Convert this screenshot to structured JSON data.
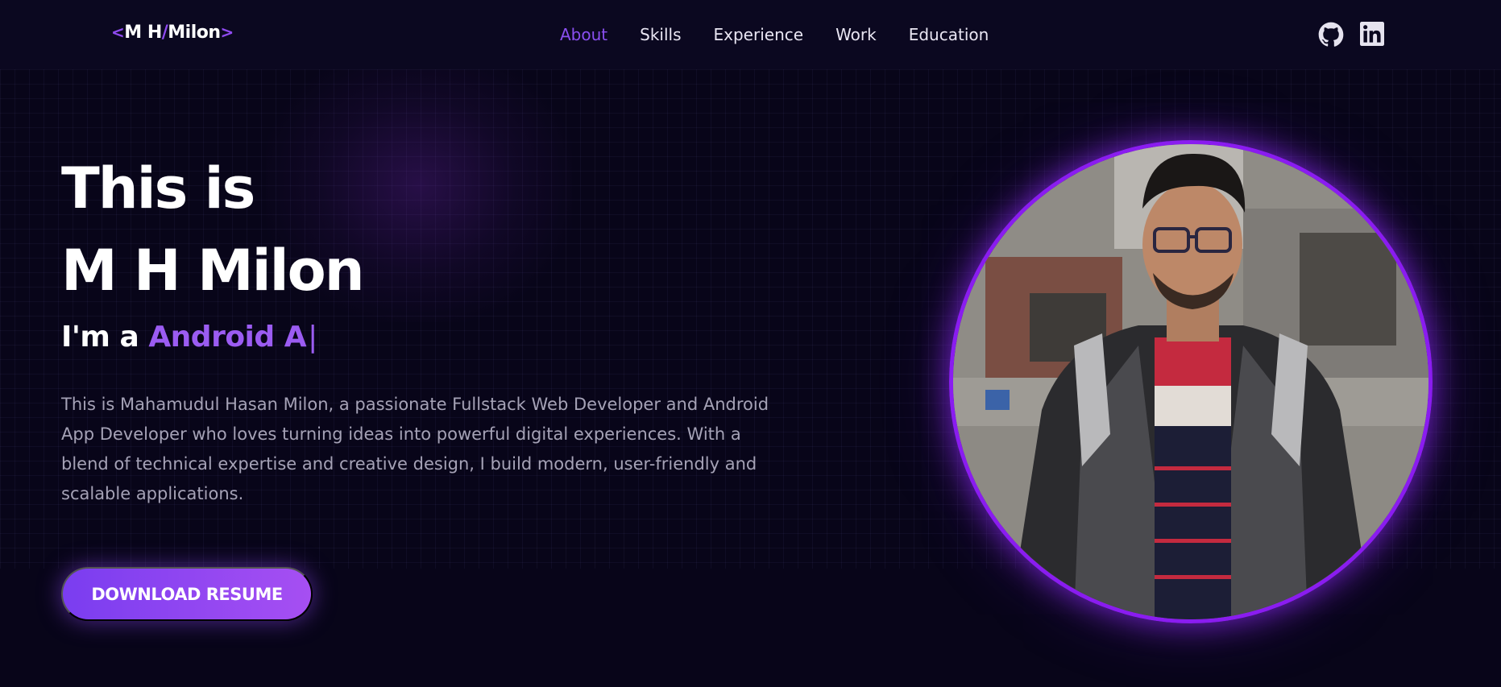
{
  "logo": {
    "open": "<",
    "left": "M H",
    "slash": "/",
    "right": "Milon",
    "close": ">"
  },
  "nav": {
    "items": [
      {
        "label": "About",
        "active": true
      },
      {
        "label": "Skills"
      },
      {
        "label": "Experience"
      },
      {
        "label": "Work"
      },
      {
        "label": "Education"
      }
    ]
  },
  "social": {
    "icons": [
      "github-icon",
      "linkedin-icon"
    ]
  },
  "hero": {
    "title_line1": "This is",
    "title_line2": "M H Milon",
    "role_prefix": "I'm a",
    "role_typed": "Android A",
    "cursor": "|",
    "description": "This is Mahamudul Hasan Milon, a passionate Fullstack Web Developer and Android App Developer who loves turning ideas into powerful digital experiences. With a blend of technical expertise and creative design, I build modern, user-friendly and scalable applications.",
    "button": "DOWNLOAD RESUME"
  },
  "colors": {
    "accent": "#8a4ff0",
    "background": "#080519",
    "ring": "#8a1cf0"
  }
}
